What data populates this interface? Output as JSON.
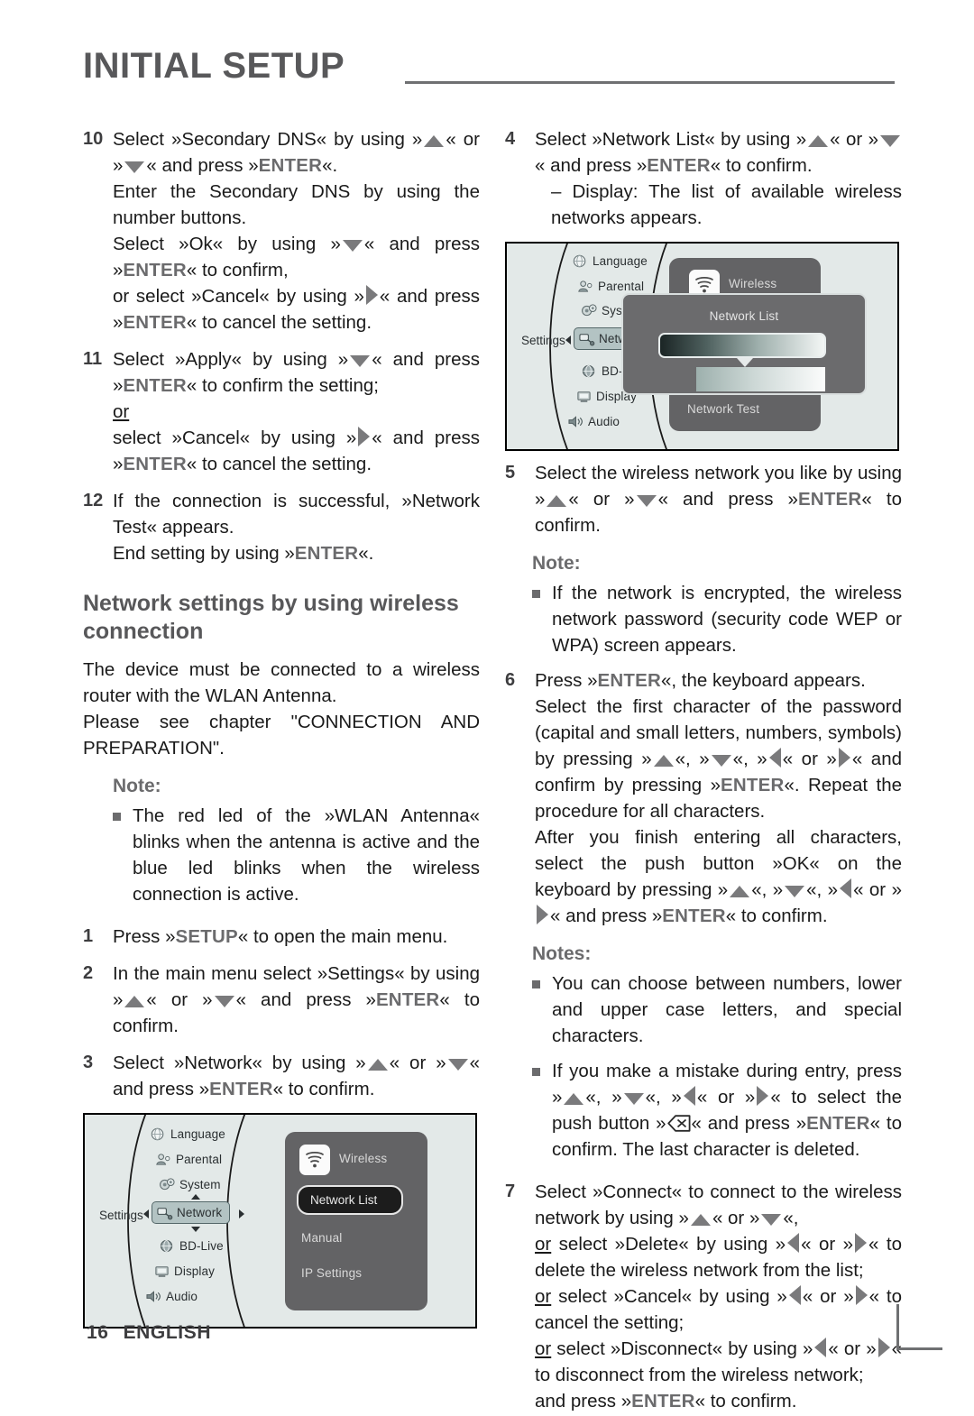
{
  "header": {
    "title": "INITIAL SETUP"
  },
  "footer": {
    "page_number": "16",
    "language": "ENGLISH"
  },
  "left_column": {
    "step10": {
      "num": "10",
      "line1_a": "Select »Secondary DNS« by using »",
      "line1_b": "« or »",
      "line1_c": "« and press »",
      "key_enter": "ENTER",
      "line1_d": "«.",
      "line2": "Enter the Secondary DNS by using the number buttons.",
      "line3_a": "Select »Ok« by using »",
      "line3_b": "« and press »",
      "line3_c": "« to confirm,",
      "line4_a": "or select »Cancel« by using »",
      "line4_b": "« and press »",
      "line4_c": "« to cancel the setting."
    },
    "step11": {
      "num": "11",
      "line1_a": "Select »Apply« by using »",
      "line1_b": "« and press »",
      "line1_c": "« to confirm the setting;",
      "or": "or",
      "line2_a": "select »Cancel« by using »",
      "line2_b": "« and press »",
      "line2_c": "« to cancel the setting."
    },
    "step12": {
      "num": "12",
      "line1": "If the connection is successful, »Network Test« appears.",
      "line2_a": "End setting by using »",
      "line2_b": "«."
    },
    "section_title": "Network settings by using wireless connection",
    "intro_p1": "The device must be connected to a wireless router with the WLAN Antenna.",
    "intro_p2": "Please see chapter \"CONNECTION AND PREPARATION\".",
    "note_label": "Note:",
    "note_bullet": "The red led of the »WLAN Antenna« blinks when the antenna is active and the blue led blinks when the wireless connection is active.",
    "step1": {
      "num": "1",
      "a": "Press »",
      "key": "SETUP",
      "b": "« to open the main menu."
    },
    "step2": {
      "num": "2",
      "a": "In the main menu select »Settings« by using »",
      "b": "« or »",
      "c": "« and press »",
      "d": "« to confirm."
    },
    "step3": {
      "num": "3",
      "a": "Select »Network« by using »",
      "b": "« or »",
      "c": "« and press »",
      "d": "« to confirm."
    }
  },
  "right_column": {
    "step4": {
      "num": "4",
      "a": "Select »Network List« by using »",
      "b": "« or »",
      "c": "« and press »",
      "d": "« to confirm.",
      "display_line": "– Display: The list of available wireless networks appears."
    },
    "step5": {
      "num": "5",
      "a": "Select the wireless network you like by using »",
      "b": "« or »",
      "c": "« and press »",
      "d": "« to confirm."
    },
    "note_label": "Note:",
    "note_bullet": "If the network is encrypted, the wireless network password (security code WEP or WPA) screen appears.",
    "step6": {
      "num": "6",
      "a": "Press »",
      "b": "«, the keyboard appears.",
      "line2_a": "Select the first character of the password (capital and small letters, numbers, symbols) by pressing »",
      "line2_b": "«, »",
      "line2_c": "«, »",
      "line2_d": "« or »",
      "line2_e": "« and confirm by pressing »",
      "line2_f": "«. Repeat the procedure for all characters.",
      "line3_a": "After you finish entering all characters, select the push button »OK« on the keyboard by pressing »",
      "line3_b": "«, »",
      "line3_c": "«, »",
      "line3_d": "« or »",
      "line3_e": "« and press »",
      "line3_f": "« to confirm."
    },
    "notes_label": "Notes:",
    "note_bullet_1": "You can choose between numbers, lower and upper case letters, and special characters.",
    "note_bullet_2": {
      "a": "If you make a mistake during entry, press »",
      "b": "«, »",
      "c": "«, »",
      "d": "« or »",
      "e": "« to select the push button »",
      "f": "« and press »",
      "g": "« to confirm. The last character is deleted."
    },
    "step7": {
      "num": "7",
      "a": "Select »Connect« to connect to the wireless network by using »",
      "b": "« or »",
      "c": "«,",
      "or1": "or",
      "d": " select »Delete« by using »",
      "e": "« or »",
      "f": "« to delete the wireless network from the list;",
      "or2": "or",
      "g": " select »Cancel« by using »",
      "h": "« or »",
      "i": "« to cancel the setting;",
      "or3": "or",
      "j": " select »Disconnect« by using »",
      "k": "« or »",
      "l": "« to disconnect from the wireless network;",
      "m_a": "and press »",
      "m_b": "« to confirm."
    }
  },
  "keys": {
    "enter": "ENTER",
    "setup": "SETUP"
  },
  "figure_left": {
    "caption_items": [
      "Language",
      "Parental",
      "System",
      "Network",
      "BD-Live",
      "Display",
      "Audio"
    ],
    "root_label": "Settings",
    "selected_item": "Network",
    "panel_items": [
      "Wireless",
      "Network List",
      "Manual",
      "IP Settings"
    ],
    "panel_highlighted": "Network List",
    "wifi_label": "Wireless"
  },
  "figure_right": {
    "caption_items": [
      "Language",
      "Parental",
      "System",
      "Network",
      "BD-Live",
      "Display",
      "Audio"
    ],
    "root_label": "Settings",
    "selected_item": "Network",
    "panel_items": [
      "Wireless",
      "Network Test"
    ],
    "wifi_label": "Wireless",
    "dialog_title": "Network List"
  },
  "colors": {
    "heading_gray": "#58585a",
    "key_gray": "#6b6b6d",
    "osd_background": "#e3e9e8",
    "osd_panel": "#636365",
    "osd_highlight": "#1c1c1c",
    "osd_selected": "#b3c3c3"
  }
}
